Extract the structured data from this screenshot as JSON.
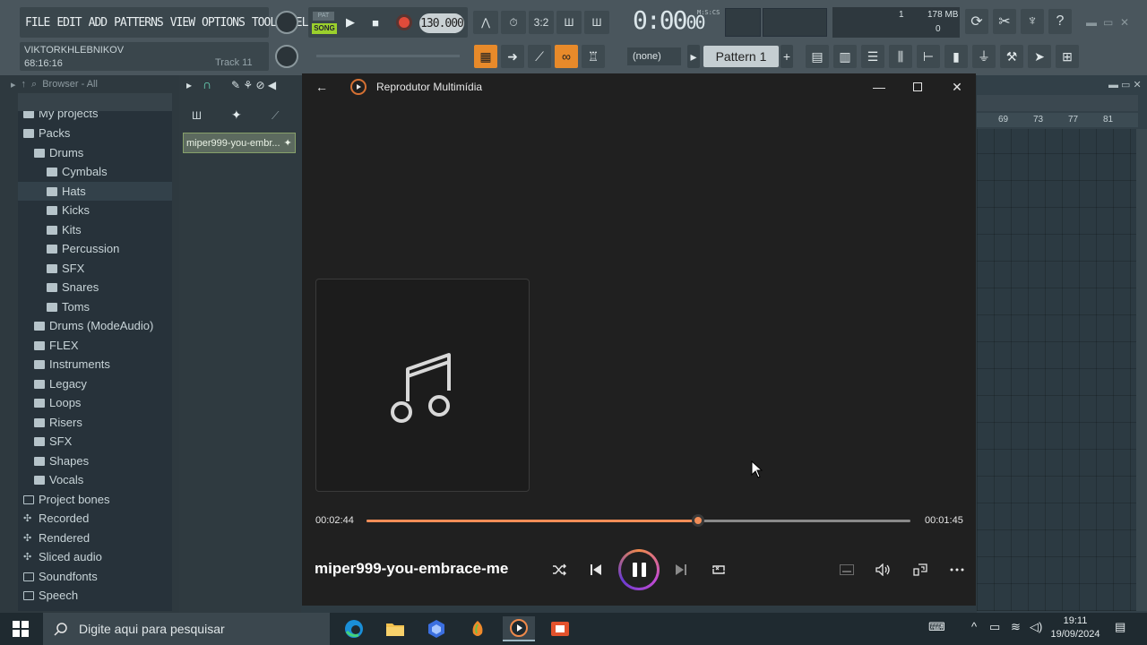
{
  "fl_studio": {
    "menu": [
      "FILE",
      "EDIT",
      "ADD",
      "PATTERNS",
      "VIEW",
      "OPTIONS",
      "TOOLS",
      "HELP"
    ],
    "user_name": "VIKTORKHLEBNIKOV",
    "elapsed_time": "68:16:16",
    "track_label": "Track 11",
    "mode_pat": "PAT",
    "mode_song": "SONG",
    "tempo": "130.000",
    "time_display": "0:00",
    "time_display_small": "00",
    "time_display_label": "M:S:CS",
    "cpu_value": "1",
    "memory": "178 MB",
    "poly_value": "0",
    "snap_value": "(none)",
    "pattern": "Pattern 1",
    "pattern_add": "+",
    "browser_head": "Browser - All",
    "rack_item": "miper999-you-embr...",
    "playlist_ruler": [
      "69",
      "73",
      "77",
      "81"
    ],
    "playlist_track_label": "Track 11"
  },
  "browser": {
    "items": [
      {
        "label": "My projects",
        "level": 0,
        "type": "folder"
      },
      {
        "label": "Packs",
        "level": 0,
        "type": "folder"
      },
      {
        "label": "Drums",
        "level": 1,
        "type": "folder"
      },
      {
        "label": "Cymbals",
        "level": 2,
        "type": "folder"
      },
      {
        "label": "Hats",
        "level": 2,
        "type": "folder",
        "selected": true
      },
      {
        "label": "Kicks",
        "level": 2,
        "type": "folder"
      },
      {
        "label": "Kits",
        "level": 2,
        "type": "folder"
      },
      {
        "label": "Percussion",
        "level": 2,
        "type": "folder"
      },
      {
        "label": "SFX",
        "level": 2,
        "type": "folder"
      },
      {
        "label": "Snares",
        "level": 2,
        "type": "folder"
      },
      {
        "label": "Toms",
        "level": 2,
        "type": "folder"
      },
      {
        "label": "Drums (ModeAudio)",
        "level": 1,
        "type": "folder"
      },
      {
        "label": "FLEX",
        "level": 1,
        "type": "folder"
      },
      {
        "label": "Instruments",
        "level": 1,
        "type": "folder"
      },
      {
        "label": "Legacy",
        "level": 1,
        "type": "folder"
      },
      {
        "label": "Loops",
        "level": 1,
        "type": "folder"
      },
      {
        "label": "Risers",
        "level": 1,
        "type": "folder"
      },
      {
        "label": "SFX",
        "level": 1,
        "type": "folder"
      },
      {
        "label": "Shapes",
        "level": 1,
        "type": "folder"
      },
      {
        "label": "Vocals",
        "level": 1,
        "type": "folder"
      },
      {
        "label": "Project bones",
        "level": 0,
        "type": "empty"
      },
      {
        "label": "Recorded",
        "level": 0,
        "type": "special"
      },
      {
        "label": "Rendered",
        "level": 0,
        "type": "special"
      },
      {
        "label": "Sliced audio",
        "level": 0,
        "type": "special"
      },
      {
        "label": "Soundfonts",
        "level": 0,
        "type": "empty"
      },
      {
        "label": "Speech",
        "level": 0,
        "type": "empty"
      }
    ]
  },
  "media_player": {
    "app_title": "Reprodutor Multimídia",
    "song_title": "miper999-you-embrace-me",
    "time_elapsed": "00:02:44",
    "time_remaining": "00:01:45",
    "progress_fraction": 0.61,
    "accent_color": "#f28d57",
    "icons": {
      "back": "arrow-left-icon",
      "minimize": "minimize-icon",
      "maximize": "maximize-icon",
      "close": "close-icon",
      "shuffle": "shuffle-icon",
      "previous": "previous-icon",
      "pause": "pause-icon",
      "next": "next-icon",
      "repeat": "repeat-icon",
      "miniplayer": "miniplayer-icon",
      "volume": "volume-icon",
      "cast": "cast-icon",
      "more": "more-icon"
    }
  },
  "taskbar": {
    "search_placeholder": "Digite aqui para pesquisar",
    "time": "19:11",
    "date": "19/09/2024"
  }
}
